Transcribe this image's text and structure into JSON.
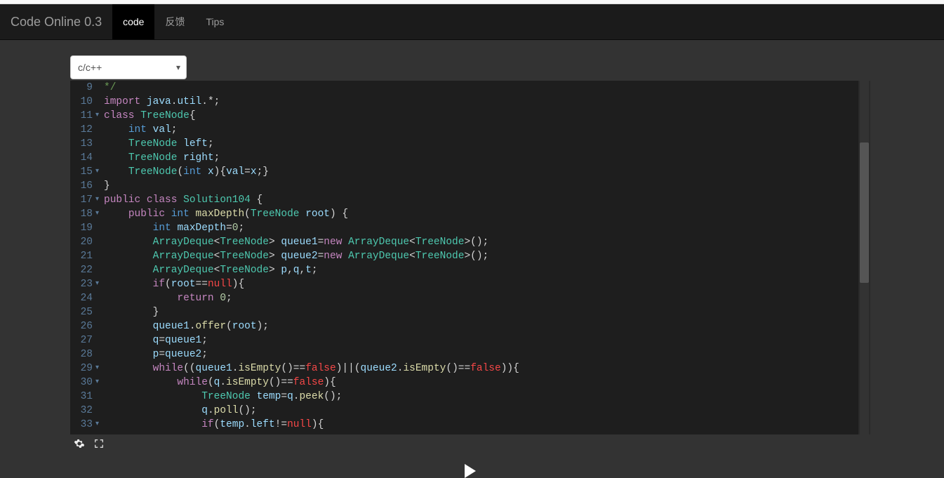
{
  "navbar": {
    "brand": "Code Online 0.3",
    "tabs": [
      {
        "label": "code",
        "active": true
      },
      {
        "label": "反馈",
        "active": false
      },
      {
        "label": "Tips",
        "active": false
      }
    ]
  },
  "language_select": {
    "selected": "c/c++"
  },
  "editor": {
    "first_line": 9,
    "fold_markers": {
      "11": "▾",
      "15": "▾",
      "17": "▾",
      "18": "▾",
      "23": "▾",
      "29": "▾",
      "30": "▾",
      "33": "▾"
    },
    "lines": [
      {
        "n": 9,
        "tokens": [
          [
            "cm",
            "*/"
          ]
        ]
      },
      {
        "n": 10,
        "tokens": [
          [
            "kw",
            "import"
          ],
          [
            "op",
            " "
          ],
          [
            "id",
            "java"
          ],
          [
            "op",
            "."
          ],
          [
            "id",
            "util"
          ],
          [
            "op",
            ".*;"
          ]
        ]
      },
      {
        "n": 11,
        "tokens": [
          [
            "kw",
            "class"
          ],
          [
            "op",
            " "
          ],
          [
            "tp",
            "TreeNode"
          ],
          [
            "op",
            "{"
          ]
        ]
      },
      {
        "n": 12,
        "tokens": [
          [
            "op",
            "    "
          ],
          [
            "def",
            "int"
          ],
          [
            "op",
            " "
          ],
          [
            "id",
            "val"
          ],
          [
            "op",
            ";"
          ]
        ]
      },
      {
        "n": 13,
        "tokens": [
          [
            "op",
            "    "
          ],
          [
            "tp",
            "TreeNode"
          ],
          [
            "op",
            " "
          ],
          [
            "id",
            "left"
          ],
          [
            "op",
            ";"
          ]
        ]
      },
      {
        "n": 14,
        "tokens": [
          [
            "op",
            "    "
          ],
          [
            "tp",
            "TreeNode"
          ],
          [
            "op",
            " "
          ],
          [
            "id",
            "right"
          ],
          [
            "op",
            ";"
          ]
        ]
      },
      {
        "n": 15,
        "tokens": [
          [
            "op",
            "    "
          ],
          [
            "tp",
            "TreeNode"
          ],
          [
            "op",
            "("
          ],
          [
            "def",
            "int"
          ],
          [
            "op",
            " "
          ],
          [
            "id",
            "x"
          ],
          [
            "op",
            "){"
          ],
          [
            "id",
            "val"
          ],
          [
            "op",
            "="
          ],
          [
            "id",
            "x"
          ],
          [
            "op",
            ";}"
          ]
        ]
      },
      {
        "n": 16,
        "tokens": [
          [
            "op",
            "}"
          ]
        ]
      },
      {
        "n": 17,
        "tokens": [
          [
            "kw",
            "public"
          ],
          [
            "op",
            " "
          ],
          [
            "kw",
            "class"
          ],
          [
            "op",
            " "
          ],
          [
            "tp",
            "Solution104"
          ],
          [
            "op",
            " {"
          ]
        ]
      },
      {
        "n": 18,
        "tokens": [
          [
            "op",
            "    "
          ],
          [
            "kw",
            "public"
          ],
          [
            "op",
            " "
          ],
          [
            "def",
            "int"
          ],
          [
            "op",
            " "
          ],
          [
            "fn",
            "maxDepth"
          ],
          [
            "op",
            "("
          ],
          [
            "tp",
            "TreeNode"
          ],
          [
            "op",
            " "
          ],
          [
            "id",
            "root"
          ],
          [
            "op",
            ") {"
          ]
        ]
      },
      {
        "n": 19,
        "tokens": [
          [
            "op",
            "        "
          ],
          [
            "def",
            "int"
          ],
          [
            "op",
            " "
          ],
          [
            "id",
            "maxDepth"
          ],
          [
            "op",
            "="
          ],
          [
            "nm",
            "0"
          ],
          [
            "op",
            ";"
          ]
        ]
      },
      {
        "n": 20,
        "tokens": [
          [
            "op",
            "        "
          ],
          [
            "tp",
            "ArrayDeque"
          ],
          [
            "op",
            "<"
          ],
          [
            "tp",
            "TreeNode"
          ],
          [
            "op",
            "> "
          ],
          [
            "id",
            "queue1"
          ],
          [
            "op",
            "="
          ],
          [
            "kw",
            "new"
          ],
          [
            "op",
            " "
          ],
          [
            "tp",
            "ArrayDeque"
          ],
          [
            "op",
            "<"
          ],
          [
            "tp",
            "TreeNode"
          ],
          [
            "op",
            ">();"
          ]
        ]
      },
      {
        "n": 21,
        "tokens": [
          [
            "op",
            "        "
          ],
          [
            "tp",
            "ArrayDeque"
          ],
          [
            "op",
            "<"
          ],
          [
            "tp",
            "TreeNode"
          ],
          [
            "op",
            "> "
          ],
          [
            "id",
            "queue2"
          ],
          [
            "op",
            "="
          ],
          [
            "kw",
            "new"
          ],
          [
            "op",
            " "
          ],
          [
            "tp",
            "ArrayDeque"
          ],
          [
            "op",
            "<"
          ],
          [
            "tp",
            "TreeNode"
          ],
          [
            "op",
            ">();"
          ]
        ]
      },
      {
        "n": 22,
        "tokens": [
          [
            "op",
            "        "
          ],
          [
            "tp",
            "ArrayDeque"
          ],
          [
            "op",
            "<"
          ],
          [
            "tp",
            "TreeNode"
          ],
          [
            "op",
            "> "
          ],
          [
            "id",
            "p"
          ],
          [
            "op",
            ","
          ],
          [
            "id",
            "q"
          ],
          [
            "op",
            ","
          ],
          [
            "id",
            "t"
          ],
          [
            "op",
            ";"
          ]
        ]
      },
      {
        "n": 23,
        "tokens": [
          [
            "op",
            "        "
          ],
          [
            "kw",
            "if"
          ],
          [
            "op",
            "("
          ],
          [
            "id",
            "root"
          ],
          [
            "op",
            "=="
          ],
          [
            "nul",
            "null"
          ],
          [
            "op",
            "){"
          ]
        ]
      },
      {
        "n": 24,
        "tokens": [
          [
            "op",
            "            "
          ],
          [
            "kw",
            "return"
          ],
          [
            "op",
            " "
          ],
          [
            "nm",
            "0"
          ],
          [
            "op",
            ";"
          ]
        ]
      },
      {
        "n": 25,
        "tokens": [
          [
            "op",
            "        }"
          ]
        ]
      },
      {
        "n": 26,
        "tokens": [
          [
            "op",
            "        "
          ],
          [
            "id",
            "queue1"
          ],
          [
            "op",
            "."
          ],
          [
            "fn",
            "offer"
          ],
          [
            "op",
            "("
          ],
          [
            "id",
            "root"
          ],
          [
            "op",
            ");"
          ]
        ]
      },
      {
        "n": 27,
        "tokens": [
          [
            "op",
            "        "
          ],
          [
            "id",
            "q"
          ],
          [
            "op",
            "="
          ],
          [
            "id",
            "queue1"
          ],
          [
            "op",
            ";"
          ]
        ]
      },
      {
        "n": 28,
        "tokens": [
          [
            "op",
            "        "
          ],
          [
            "id",
            "p"
          ],
          [
            "op",
            "="
          ],
          [
            "id",
            "queue2"
          ],
          [
            "op",
            ";"
          ]
        ]
      },
      {
        "n": 29,
        "tokens": [
          [
            "op",
            "        "
          ],
          [
            "kw",
            "while"
          ],
          [
            "op",
            "(("
          ],
          [
            "id",
            "queue1"
          ],
          [
            "op",
            "."
          ],
          [
            "fn",
            "isEmpty"
          ],
          [
            "op",
            "()=="
          ],
          [
            "nul",
            "false"
          ],
          [
            "op",
            ")||("
          ],
          [
            "id",
            "queue2"
          ],
          [
            "op",
            "."
          ],
          [
            "fn",
            "isEmpty"
          ],
          [
            "op",
            "()=="
          ],
          [
            "nul",
            "false"
          ],
          [
            "op",
            ")){"
          ]
        ]
      },
      {
        "n": 30,
        "tokens": [
          [
            "op",
            "            "
          ],
          [
            "kw",
            "while"
          ],
          [
            "op",
            "("
          ],
          [
            "id",
            "q"
          ],
          [
            "op",
            "."
          ],
          [
            "fn",
            "isEmpty"
          ],
          [
            "op",
            "()=="
          ],
          [
            "nul",
            "false"
          ],
          [
            "op",
            "){"
          ]
        ]
      },
      {
        "n": 31,
        "tokens": [
          [
            "op",
            "                "
          ],
          [
            "tp",
            "TreeNode"
          ],
          [
            "op",
            " "
          ],
          [
            "id",
            "temp"
          ],
          [
            "op",
            "="
          ],
          [
            "id",
            "q"
          ],
          [
            "op",
            "."
          ],
          [
            "fn",
            "peek"
          ],
          [
            "op",
            "();"
          ]
        ]
      },
      {
        "n": 32,
        "tokens": [
          [
            "op",
            "                "
          ],
          [
            "id",
            "q"
          ],
          [
            "op",
            "."
          ],
          [
            "fn",
            "poll"
          ],
          [
            "op",
            "();"
          ]
        ]
      },
      {
        "n": 33,
        "tokens": [
          [
            "op",
            "                "
          ],
          [
            "kw",
            "if"
          ],
          [
            "op",
            "("
          ],
          [
            "id",
            "temp"
          ],
          [
            "op",
            "."
          ],
          [
            "id",
            "left"
          ],
          [
            "op",
            "!="
          ],
          [
            "nul",
            "null"
          ],
          [
            "op",
            "){"
          ]
        ]
      }
    ]
  },
  "icons": {
    "settings": "settings-icon",
    "fullscreen": "fullscreen-icon",
    "run": "run-icon"
  }
}
